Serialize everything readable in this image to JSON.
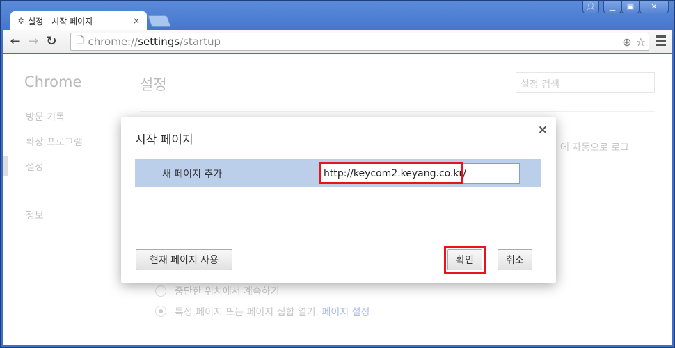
{
  "window": {
    "controls": {
      "profile_icon": "person-icon",
      "minimize_icon": "minimize-icon",
      "maximize_icon": "maximize-icon",
      "close_icon": "close-icon"
    }
  },
  "tab": {
    "icon": "gear-icon",
    "title": "설정 - 시작 페이지",
    "close": "×"
  },
  "omnibox": {
    "prefix": "chrome://",
    "host": "settings",
    "path": "/startup"
  },
  "sidebar": {
    "brand": "Chrome",
    "items": [
      {
        "label": "방문 기록"
      },
      {
        "label": "확장 프로그램"
      },
      {
        "label": "설정"
      },
      {
        "label": "정보"
      }
    ]
  },
  "main": {
    "title": "설정",
    "search_placeholder": "설정 검색",
    "partial_text": "에 자동으로 로그",
    "radio_options": [
      {
        "label": "중단한 위치에서 계속하기",
        "checked": false
      },
      {
        "label": "특정 페이지 또는 페이지 집합 열기.",
        "checked": true,
        "link": "페이지 설정"
      }
    ]
  },
  "dialog": {
    "title": "시작 페이지",
    "close": "×",
    "row_label": "새 페이지 추가",
    "url_value": "http://keycom2.keyang.co.kr/",
    "use_current": "현재 페이지 사용",
    "ok": "확인",
    "cancel": "취소"
  },
  "colors": {
    "highlight": "#e8141c",
    "row_selected": "#bccfea",
    "titlebar": "#3f6fc8"
  }
}
